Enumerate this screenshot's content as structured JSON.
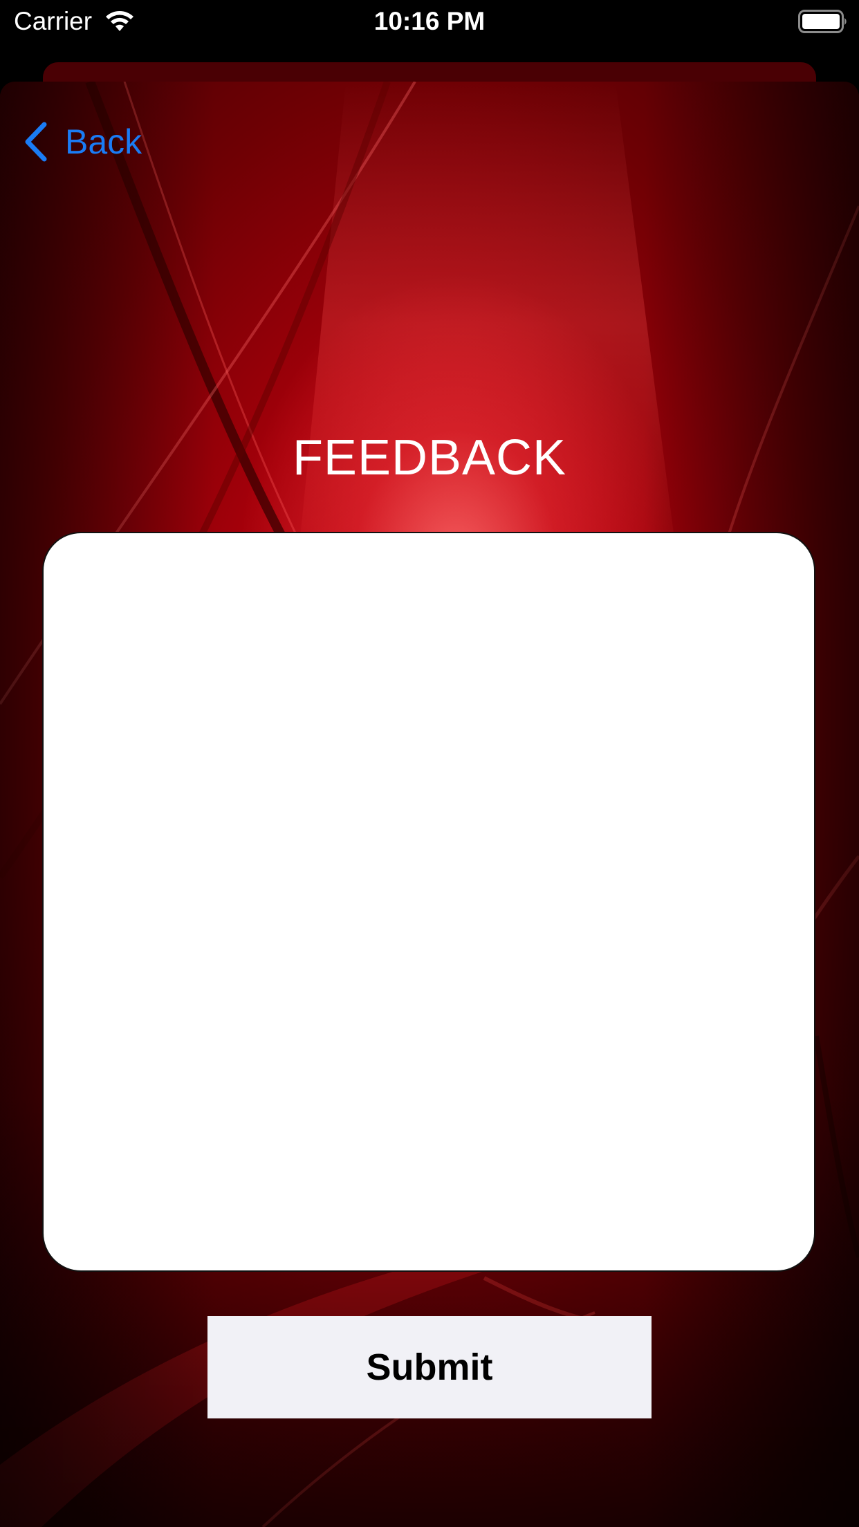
{
  "status_bar": {
    "carrier": "Carrier",
    "time": "10:16 PM",
    "wifi_icon": "wifi-icon",
    "battery_icon": "battery-icon"
  },
  "nav": {
    "back_label": "Back",
    "back_icon": "chevron-left-icon"
  },
  "page": {
    "title": "FEEDBACK"
  },
  "feedback_field": {
    "value": "",
    "placeholder": ""
  },
  "actions": {
    "submit_label": "Submit"
  },
  "colors": {
    "accent_blue": "#1a7cf5",
    "background_red": "#a4000a",
    "button_background": "#f1f1f6"
  }
}
